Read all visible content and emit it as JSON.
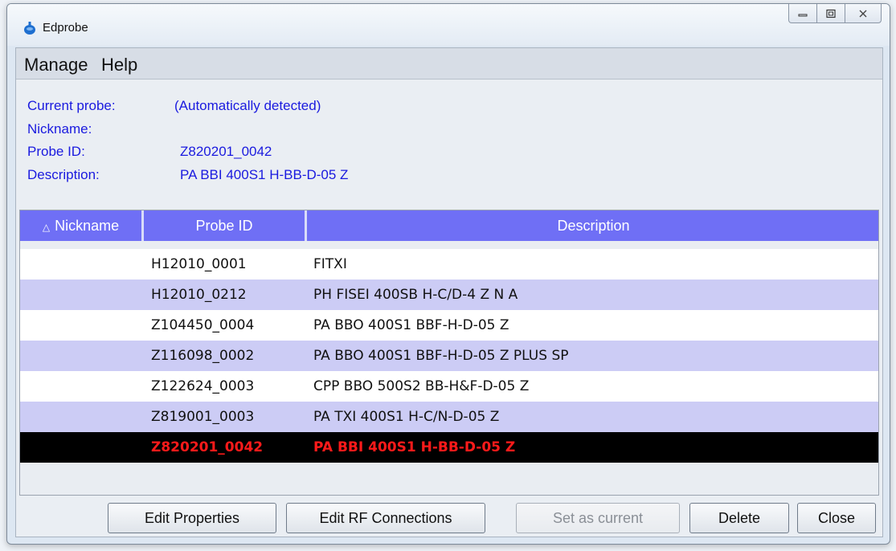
{
  "window": {
    "title": "Edprobe"
  },
  "menu": {
    "items": [
      "Manage",
      "Help"
    ]
  },
  "current": {
    "current_probe_label": "Current probe:",
    "current_probe_value": "(Automatically detected)",
    "nickname_label": "Nickname:",
    "nickname_value": "",
    "probe_id_label": "Probe ID:",
    "probe_id_value": "Z820201_0042",
    "description_label": "Description:",
    "description_value": "PA BBI 400S1 H-BB-D-05 Z"
  },
  "table": {
    "sort_indicator": "△",
    "columns": [
      "Nickname",
      "Probe ID",
      "Description"
    ],
    "rows": [
      {
        "nickname": "",
        "probe_id": "H12010_0001",
        "description": "FITXI"
      },
      {
        "nickname": "",
        "probe_id": "H12010_0212",
        "description": "PH FISEI 400SB H-C/D-4 Z N A"
      },
      {
        "nickname": "",
        "probe_id": "Z104450_0004",
        "description": "PA BBO 400S1 BBF-H-D-05 Z"
      },
      {
        "nickname": "",
        "probe_id": "Z116098_0002",
        "description": "PA BBO 400S1 BBF-H-D-05 Z PLUS SP"
      },
      {
        "nickname": "",
        "probe_id": "Z122624_0003",
        "description": "CPP BBO 500S2 BB-H&F-D-05 Z"
      },
      {
        "nickname": "",
        "probe_id": "Z819001_0003",
        "description": "PA TXI 400S1 H-C/N-D-05 Z"
      },
      {
        "nickname": "",
        "probe_id": "Z820201_0042",
        "description": "PA BBI 400S1 H-BB-D-05 Z"
      }
    ],
    "selected_row": 6
  },
  "buttons": {
    "edit_properties": "Edit Properties",
    "edit_rf_connections": "Edit RF Connections",
    "set_as_current": "Set as current",
    "delete": "Delete",
    "close": "Close"
  },
  "colors": {
    "header_bg": "#6f6ff5",
    "row_alt": "#ccccf5",
    "selected_bg": "#000000",
    "selected_text": "#ff1a1a",
    "info_text": "#1a1adf"
  },
  "icons": [
    "app-probe-icon",
    "minimize-icon",
    "maximize-icon",
    "close-icon"
  ]
}
